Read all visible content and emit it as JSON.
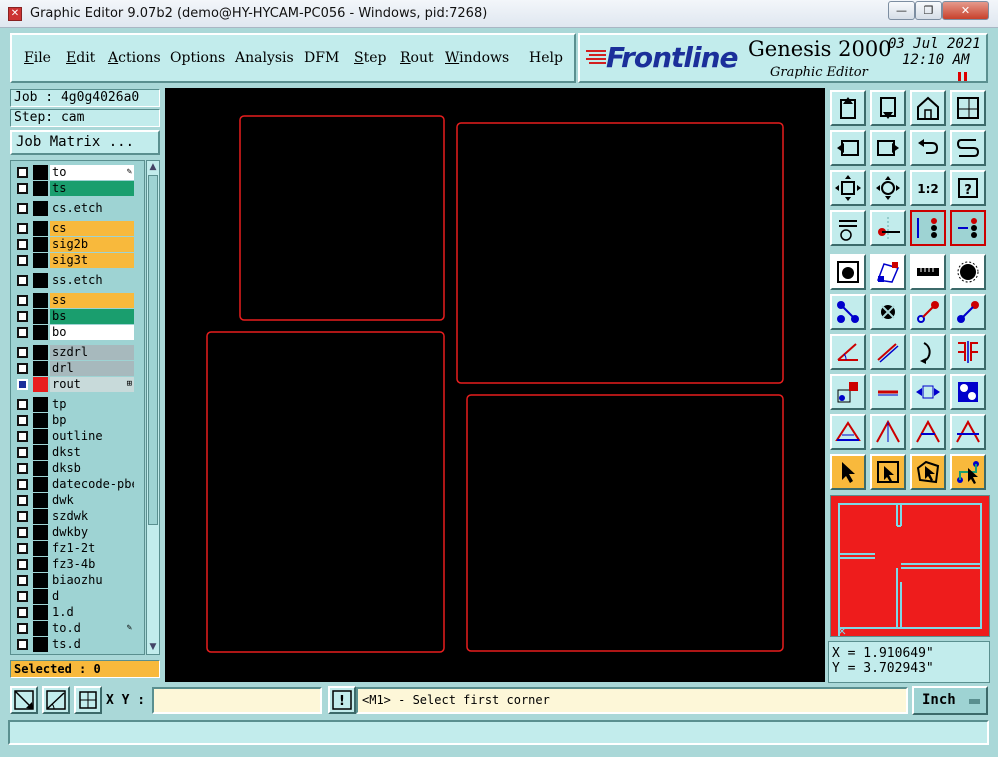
{
  "window": {
    "title": "Graphic Editor 9.07b2 (demo@HY-HYCAM-PC056 - Windows, pid:7268)",
    "minimize_glyph": "—",
    "maximize_glyph": "❐",
    "close_glyph": "✕"
  },
  "menu": {
    "items": [
      "File",
      "Edit",
      "Actions",
      "Options",
      "Analysis",
      "DFM",
      "Step",
      "Rout",
      "Windows",
      "Help"
    ]
  },
  "brand": {
    "logo": "Frontline",
    "product": "Genesis 2000",
    "subtitle": "Graphic Editor",
    "date": "03 Jul 2021",
    "time": "12:10 AM"
  },
  "job": {
    "job_label": "Job : 4g0g4026a0",
    "step_label": "Step: cam",
    "matrix_button": "Job Matrix ..."
  },
  "layers": [
    {
      "name": "to",
      "color": "#ffffff",
      "mark": "✎"
    },
    {
      "name": "ts",
      "color": "#1a9e6e",
      "mark": ""
    },
    {
      "name": "cs.etch",
      "color": "#9ed3d3",
      "mark": ""
    },
    {
      "name": "cs",
      "color": "#f8b93c",
      "mark": ""
    },
    {
      "name": "sig2b",
      "color": "#f8b93c",
      "mark": ""
    },
    {
      "name": "sig3t",
      "color": "#f8b93c",
      "mark": ""
    },
    {
      "name": "ss.etch",
      "color": "#9ed3d3",
      "mark": ""
    },
    {
      "name": "ss",
      "color": "#f8b93c",
      "mark": ""
    },
    {
      "name": "bs",
      "color": "#1a9e6e",
      "mark": ""
    },
    {
      "name": "bo",
      "color": "#ffffff",
      "mark": ""
    },
    {
      "name": "szdrl",
      "color": "#a7b9bd",
      "mark": ""
    },
    {
      "name": "drl",
      "color": "#a7b9bd",
      "mark": ""
    },
    {
      "name": "rout",
      "color": "#c8dada",
      "mark": "⊞",
      "active": true
    },
    {
      "name": "tp",
      "color": "#9ed3d3",
      "mark": ""
    },
    {
      "name": "bp",
      "color": "#9ed3d3",
      "mark": ""
    },
    {
      "name": "outline",
      "color": "#9ed3d3",
      "mark": ""
    },
    {
      "name": "dkst",
      "color": "#9ed3d3",
      "mark": ""
    },
    {
      "name": "dksb",
      "color": "#9ed3d3",
      "mark": ""
    },
    {
      "name": "datecode-pbe",
      "color": "#9ed3d3",
      "mark": ""
    },
    {
      "name": "dwk",
      "color": "#9ed3d3",
      "mark": ""
    },
    {
      "name": "szdwk",
      "color": "#9ed3d3",
      "mark": ""
    },
    {
      "name": "dwkby",
      "color": "#9ed3d3",
      "mark": ""
    },
    {
      "name": "fz1-2t",
      "color": "#9ed3d3",
      "mark": ""
    },
    {
      "name": "fz3-4b",
      "color": "#9ed3d3",
      "mark": ""
    },
    {
      "name": "biaozhu",
      "color": "#9ed3d3",
      "mark": ""
    },
    {
      "name": "d",
      "color": "#9ed3d3",
      "mark": ""
    },
    {
      "name": "1.d",
      "color": "#9ed3d3",
      "mark": ""
    },
    {
      "name": "to.d",
      "color": "#9ed3d3",
      "mark": "✎"
    },
    {
      "name": "ts.d",
      "color": "#9ed3d3",
      "mark": ""
    }
  ],
  "selected": {
    "label": "Selected : 0"
  },
  "tools": {
    "zoom_one_to_one": "1:2",
    "help": "?"
  },
  "coords": {
    "x": "X = 1.910649\"",
    "y": "Y = 3.702943\""
  },
  "bottom": {
    "xy_label": "X Y :",
    "xy_value": "",
    "warn_glyph": "!",
    "prompt": "<M1> - Select first corner",
    "units": "Inch",
    "status": ""
  },
  "colors": {
    "frame": "#aad8d8",
    "panel": "#c2ecec",
    "canvas": "#000000",
    "outline": "#e81e1e",
    "thumbnail": "#ee1c1c",
    "thumbnail_lines": "#7fd9e6"
  }
}
